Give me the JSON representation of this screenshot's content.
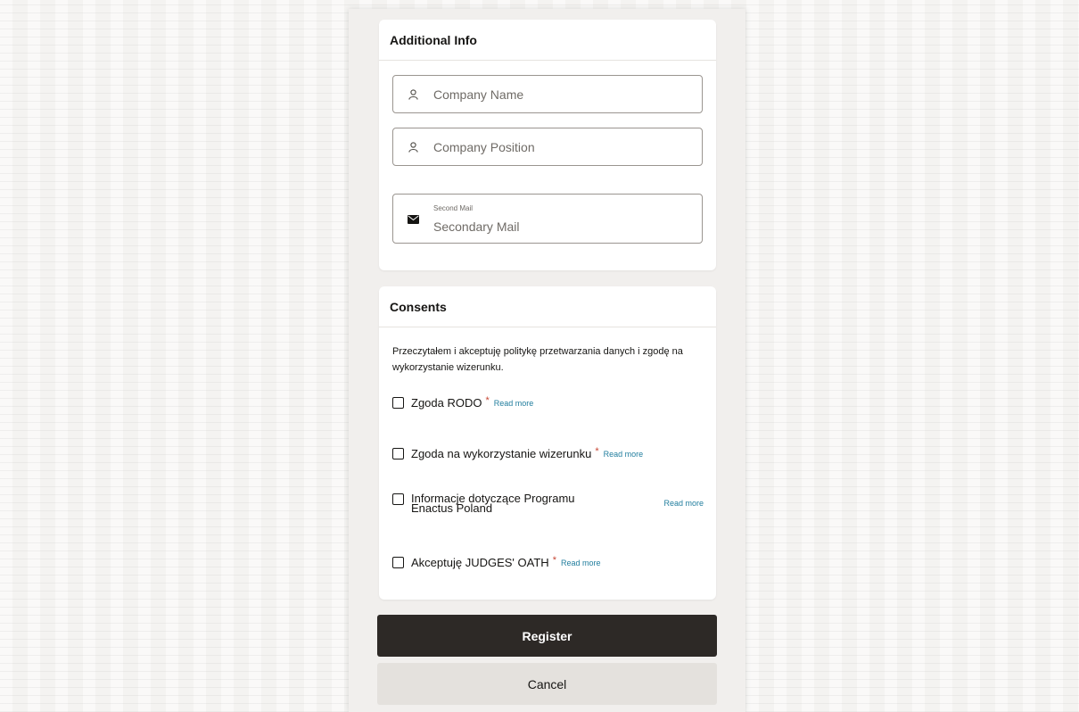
{
  "additional_info": {
    "title": "Additional Info",
    "company_name": {
      "placeholder": "Company Name",
      "value": "",
      "icon": "user-icon"
    },
    "company_position": {
      "placeholder": "Company Position",
      "value": "",
      "icon": "user-icon"
    },
    "second_mail": {
      "label": "Second Mail",
      "placeholder": "Secondary Mail",
      "value": "",
      "icon": "envelope-icon"
    }
  },
  "consents": {
    "title": "Consents",
    "intro": "Przeczytałem i akceptuję politykę przetwarzania danych i zgodę na wykorzystanie wizerunku.",
    "items": [
      {
        "label": "Zgoda RODO",
        "required": "*",
        "read_more": "Read more",
        "checked": false
      },
      {
        "label": "Zgoda na wykorzystanie wizerunku",
        "required": "*",
        "read_more": "Read more",
        "checked": false
      },
      {
        "label_line1": "Informacje dotyczące Programu",
        "label_line2": "Enactus Poland",
        "read_more": "Read more",
        "checked": false
      },
      {
        "label": "Akceptuję JUDGES' OATH",
        "required": "*",
        "read_more": "Read more",
        "checked": false
      }
    ]
  },
  "actions": {
    "register": "Register",
    "cancel": "Cancel"
  },
  "colors": {
    "primary_button": "#2d2926",
    "secondary_button": "#e4e1dd",
    "link": "#227e9e",
    "required_mark": "#c74634"
  }
}
